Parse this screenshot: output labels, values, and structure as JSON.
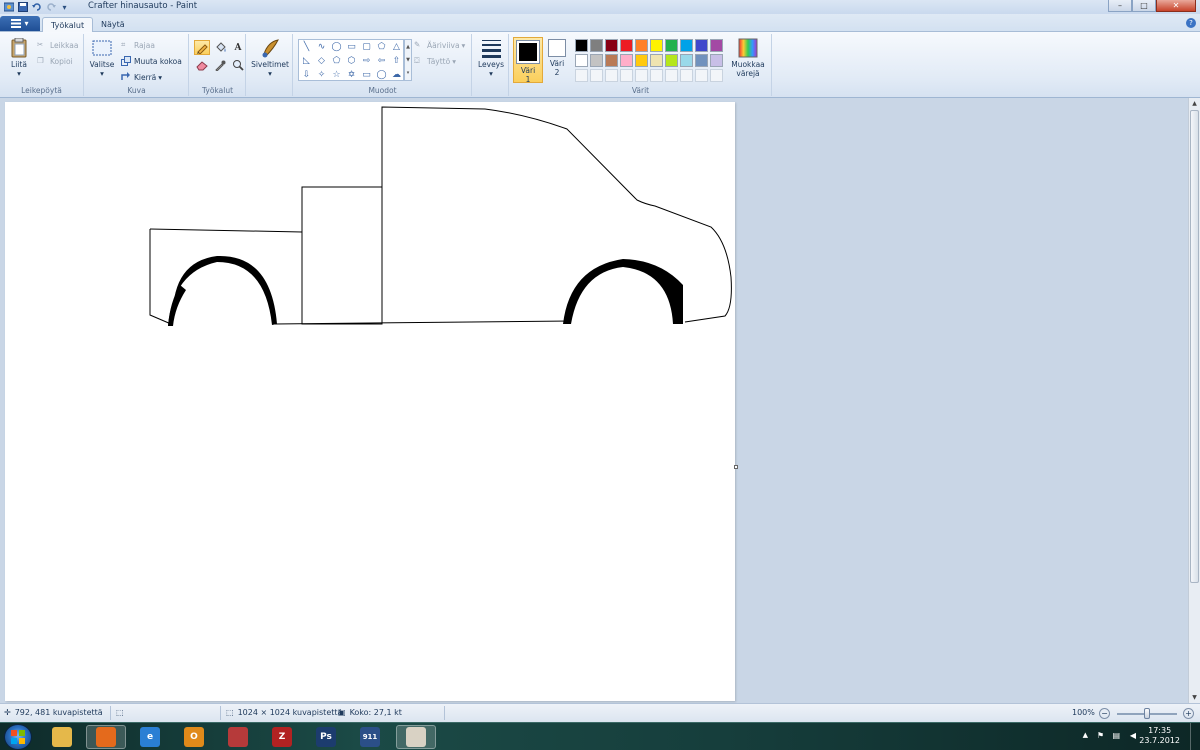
{
  "titlebar": {
    "title": "Crafter hinausauto - Paint",
    "quick_access": [
      "paint-app-icon",
      "save-icon",
      "undo-icon",
      "redo-icon",
      "customize-dropdown-icon"
    ],
    "controls": [
      "minimize-icon",
      "maximize-icon",
      "close-icon"
    ]
  },
  "tabs": {
    "app_menu": "▾",
    "items": [
      {
        "label": "Työkalut",
        "active": true
      },
      {
        "label": "Näytä",
        "active": false
      }
    ],
    "help": "?"
  },
  "ribbon": {
    "clipboard": {
      "label": "Leikepöytä",
      "paste": "Liitä",
      "cut": "Leikkaa",
      "copy": "Kopioi"
    },
    "image": {
      "label": "Kuva",
      "select": "Valitse",
      "crop": "Rajaa",
      "resize": "Muuta kokoa",
      "rotate": "Kierrä"
    },
    "tools": {
      "label": "Työkalut",
      "items": [
        "pencil-icon",
        "fill-icon",
        "text-icon",
        "eraser-icon",
        "color-picker-icon",
        "magnifier-icon"
      ]
    },
    "brushes": {
      "label": "Siveltimet"
    },
    "shapes": {
      "label": "Muodot",
      "outline": "Ääriviiva",
      "fill": "Täyttö",
      "items": [
        "line",
        "curve",
        "oval",
        "rectangle",
        "rounded-rectangle",
        "polygon",
        "triangle",
        "right-triangle",
        "diamond",
        "pentagon",
        "hexagon",
        "right-arrow",
        "left-arrow",
        "up-arrow",
        "down-arrow",
        "four-point-star",
        "five-point-star",
        "six-point-star",
        "rounded-callout",
        "oval-callout",
        "cloud-callout"
      ]
    },
    "size": {
      "label": "Leveys"
    },
    "colors": {
      "label": "Värit",
      "color1_label": "Väri\n1",
      "color1_line1": "Väri",
      "color1_line2": "1",
      "color2_line1": "Väri",
      "color2_line2": "2",
      "color1": "#000000",
      "color2": "#ffffff",
      "edit_line1": "Muokkaa",
      "edit_line2": "värejä",
      "palette": [
        "#000000",
        "#7f7f7f",
        "#880015",
        "#ed1c24",
        "#ff7f27",
        "#fff200",
        "#22b14c",
        "#00a2e8",
        "#3f48cc",
        "#a349a4",
        "#ffffff",
        "#c3c3c3",
        "#b97a57",
        "#ffaec9",
        "#ffc90e",
        "#efe4b0",
        "#b5e61d",
        "#99d9ea",
        "#7092be",
        "#c8bfe7"
      ]
    }
  },
  "statusbar": {
    "cursor_pos": "792, 481 kuvapistettä",
    "image_size": "1024 × 1024 kuvapistettä",
    "file_size": "Koko: 27,1 kt",
    "zoom": "100%",
    "zoom_out": "−",
    "zoom_in": "+"
  },
  "taskbar": {
    "items": [
      {
        "name": "windows-explorer-icon",
        "color": "#e5b84a",
        "glyph": ""
      },
      {
        "name": "firefox-icon",
        "color": "#e46a1c",
        "glyph": ""
      },
      {
        "name": "internet-explorer-icon",
        "color": "#2a7fd4",
        "glyph": "e"
      },
      {
        "name": "outlook-icon",
        "color": "#e08a1a",
        "glyph": "O"
      },
      {
        "name": "app-icon",
        "color": "#b63a3a",
        "glyph": ""
      },
      {
        "name": "filezilla-icon",
        "color": "#b22222",
        "glyph": "Z"
      },
      {
        "name": "photoshop-icon",
        "color": "#1c3c6e",
        "glyph": "Ps"
      },
      {
        "name": "911-icon",
        "color": "#2b4f88",
        "glyph": "911"
      },
      {
        "name": "paint-icon",
        "color": "#d9d2c4",
        "glyph": ""
      }
    ],
    "time": "17:35",
    "date": "23.7.2012"
  }
}
